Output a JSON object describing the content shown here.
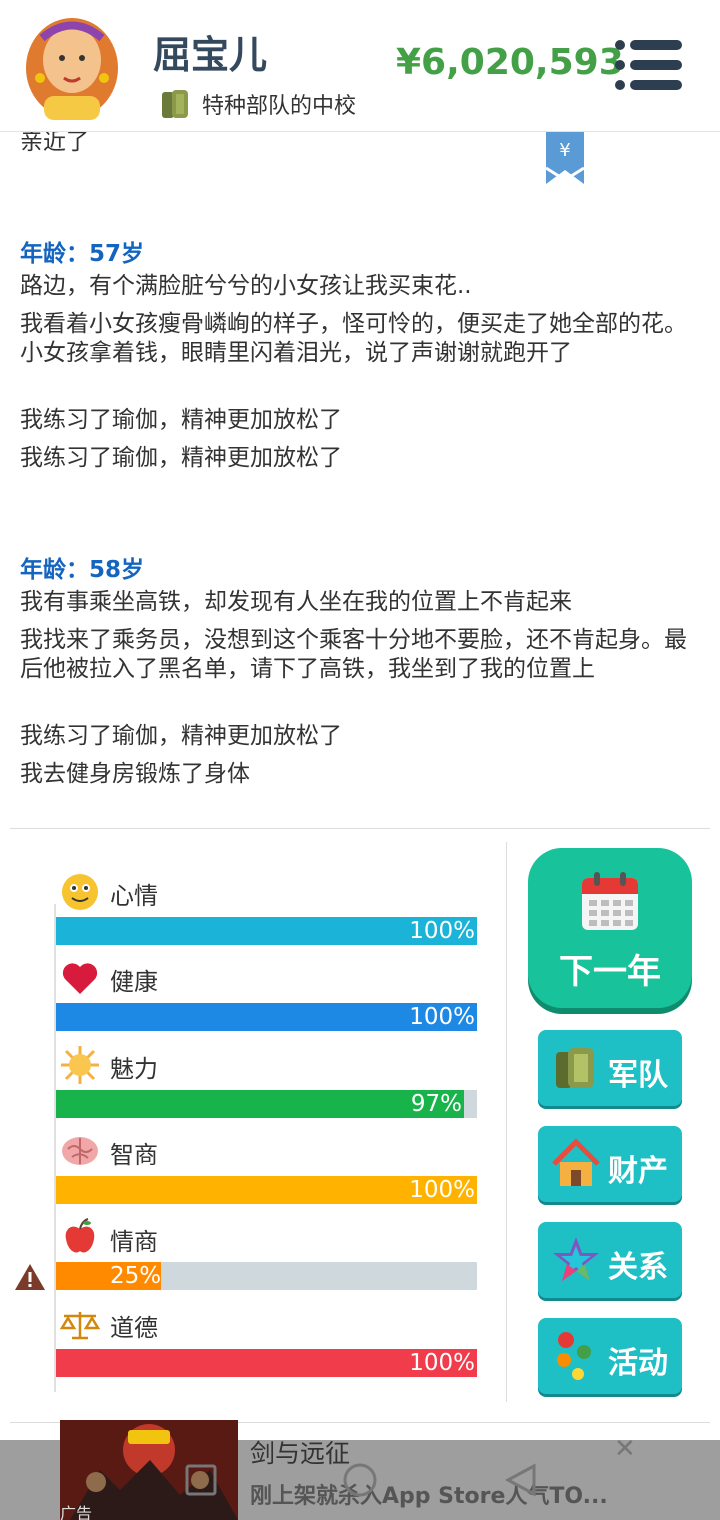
{
  "header": {
    "name": "屈宝儿",
    "rank": "特种部队的中校",
    "money": "¥6,020,593"
  },
  "log": {
    "fragment": "亲近了",
    "entries": [
      {
        "age": "年龄：57岁",
        "lines": [
          "路边，有个满脸脏兮兮的小女孩让我买束花..",
          "我看着小女孩瘦骨嶙峋的样子，怪可怜的，便买走了她全部的花。小女孩拿着钱，眼睛里闪着泪光，说了声谢谢就跑开了",
          "我练习了瑜伽，精神更加放松了",
          "我练习了瑜伽，精神更加放松了"
        ]
      },
      {
        "age": "年龄：58岁",
        "lines": [
          "我有事乘坐高铁，却发现有人坐在我的位置上不肯起来",
          "我找来了乘务员，没想到这个乘客十分地不要脸，还不肯起身。最后他被拉入了黑名单，请下了高铁，我坐到了我的位置上",
          "我练习了瑜伽，精神更加放松了",
          "我去健身房锻炼了身体"
        ]
      }
    ]
  },
  "stats": [
    {
      "label": "心情",
      "value": "100%",
      "fraction": 1.0,
      "color": "#1bb3d8",
      "icon": "smiley-icon"
    },
    {
      "label": "健康",
      "value": "100%",
      "fraction": 1.0,
      "color": "#1e88e5",
      "icon": "heart-icon"
    },
    {
      "label": "魅力",
      "value": "97%",
      "fraction": 0.97,
      "color": "#18b34a",
      "icon": "sun-icon"
    },
    {
      "label": "智商",
      "value": "100%",
      "fraction": 1.0,
      "color": "#ffb300",
      "icon": "brain-icon"
    },
    {
      "label": "情商",
      "value": "25%",
      "fraction": 0.25,
      "color": "#ff8a00",
      "icon": "apple-icon"
    },
    {
      "label": "道德",
      "value": "100%",
      "fraction": 1.0,
      "color": "#f03c4b",
      "icon": "scales-icon"
    }
  ],
  "actions": {
    "next_year": "下一年",
    "army": "军队",
    "property": "财产",
    "relations": "关系",
    "activities": "活动"
  },
  "ad": {
    "title": "剑与远征",
    "desc": "刚上架就杀入App Store人气TO...",
    "tag": "广告"
  }
}
